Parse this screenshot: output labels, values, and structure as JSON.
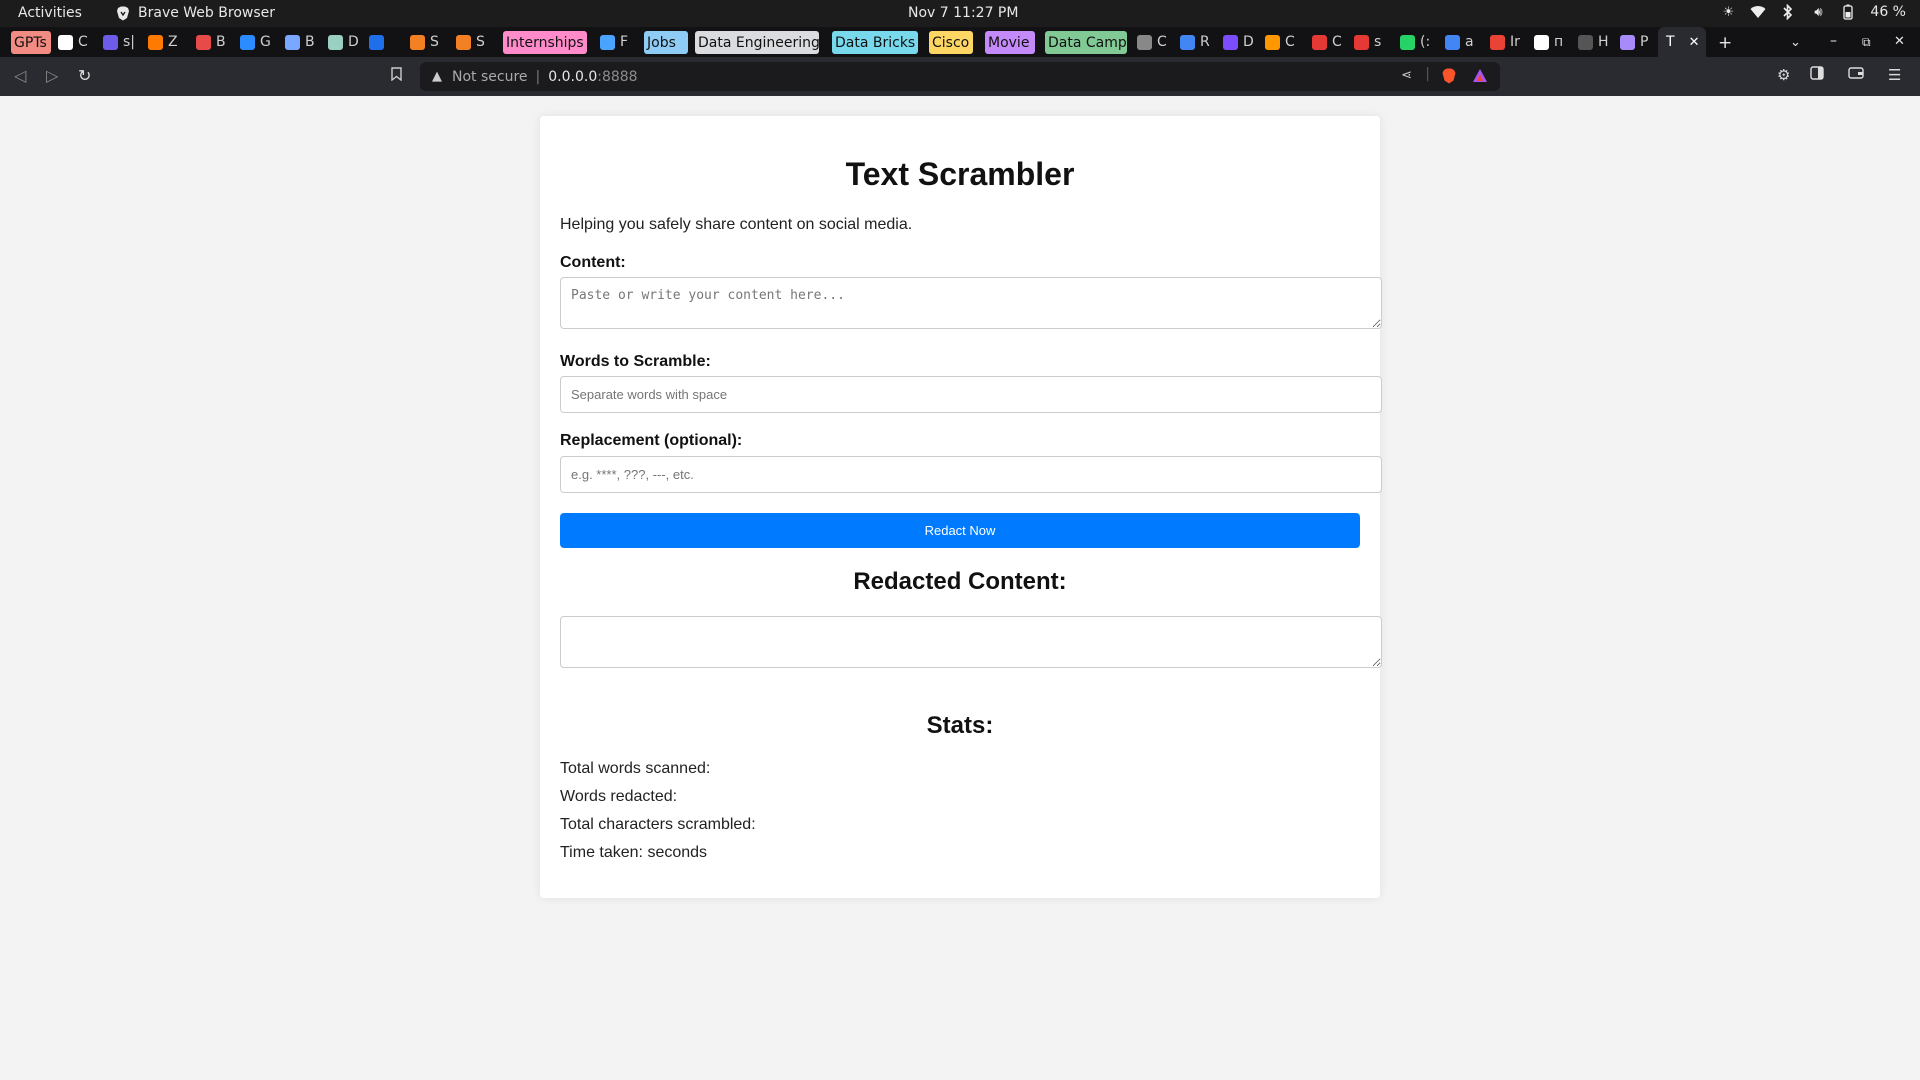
{
  "system": {
    "activities": "Activities",
    "app_name": "Brave Web Browser",
    "clock": "Nov 7  11:27 PM",
    "battery": "46 %"
  },
  "tabs": {
    "items": [
      {
        "label": "GPTs",
        "kind": "chip",
        "color": "#f28b82"
      },
      {
        "label": "C",
        "kind": "tab",
        "fav": "#ffffff"
      },
      {
        "label": "s|",
        "kind": "tab",
        "fav": "#6c5ce7"
      },
      {
        "label": "Z",
        "kind": "tab",
        "fav": "#ff7a00"
      },
      {
        "label": "B",
        "kind": "tab",
        "fav": "#e84a4a"
      },
      {
        "label": "G",
        "kind": "tab",
        "fav": "#2a8cff"
      },
      {
        "label": "B",
        "kind": "tab",
        "fav": "#7aa7ff"
      },
      {
        "label": "D",
        "kind": "tab",
        "fav": "#9ad0c2"
      },
      {
        "label": "",
        "kind": "tab",
        "fav": "#1f6feb"
      },
      {
        "label": "S",
        "kind": "tab",
        "fav": "#f48024"
      },
      {
        "label": "S",
        "kind": "tab",
        "fav": "#f48024"
      },
      {
        "label": "Internships",
        "kind": "chip",
        "color": "#ff8bcb"
      },
      {
        "label": "F",
        "kind": "tab",
        "fav": "#4aa3ff"
      },
      {
        "label": "Jobs",
        "kind": "chip",
        "color": "#8ecbf5"
      },
      {
        "label": "Data Engineering",
        "kind": "chip",
        "color": "#dadce0"
      },
      {
        "label": "Data Bricks",
        "kind": "chip",
        "color": "#78d9ec"
      },
      {
        "label": "Cisco",
        "kind": "chip",
        "color": "#fdd663"
      },
      {
        "label": "Movie",
        "kind": "chip",
        "color": "#c58af9"
      },
      {
        "label": "Data Camp",
        "kind": "chip",
        "color": "#81c995"
      },
      {
        "label": "C",
        "kind": "tab",
        "fav": "#888888"
      },
      {
        "label": "R",
        "kind": "tab",
        "fav": "#4285f4"
      },
      {
        "label": "D",
        "kind": "tab",
        "fav": "#7c4dff"
      },
      {
        "label": "C",
        "kind": "tab",
        "fav": "#ff9800"
      },
      {
        "label": "C",
        "kind": "tab",
        "fav": "#e53935"
      },
      {
        "label": "s",
        "kind": "tab",
        "fav": "#e53935"
      },
      {
        "label": "(:",
        "kind": "tab",
        "fav": "#25d366"
      },
      {
        "label": "a",
        "kind": "tab",
        "fav": "#4285f4"
      },
      {
        "label": "Ir",
        "kind": "tab",
        "fav": "#ea4335"
      },
      {
        "label": "п",
        "kind": "tab",
        "fav": "#ffffff"
      },
      {
        "label": "H",
        "kind": "tab",
        "fav": "#555555"
      },
      {
        "label": "P",
        "kind": "tab",
        "fav": "#a78bfa"
      }
    ],
    "active": {
      "label": "T",
      "close": "✕"
    },
    "new_tab": "+"
  },
  "toolbar": {
    "security": "Not secure",
    "host": "0.0.0.0",
    "port": ":8888"
  },
  "page": {
    "title": "Text Scrambler",
    "intro": "Helping you safely share content on social media.",
    "content_label": "Content:",
    "content_placeholder": "Paste or write your content here...",
    "content_value": "",
    "words_label": "Words to Scramble:",
    "words_placeholder": "Separate words with space",
    "words_value": "",
    "replacement_label": "Replacement (optional):",
    "replacement_placeholder": "e.g. ****, ???, ---, etc.",
    "replacement_value": "",
    "button": "Redact Now",
    "redacted_heading": "Redacted Content:",
    "redacted_value": "",
    "stats_heading": "Stats:",
    "stats": [
      "Total words scanned:",
      "Words redacted:",
      "Total characters scrambled:",
      "Time taken: seconds"
    ]
  }
}
